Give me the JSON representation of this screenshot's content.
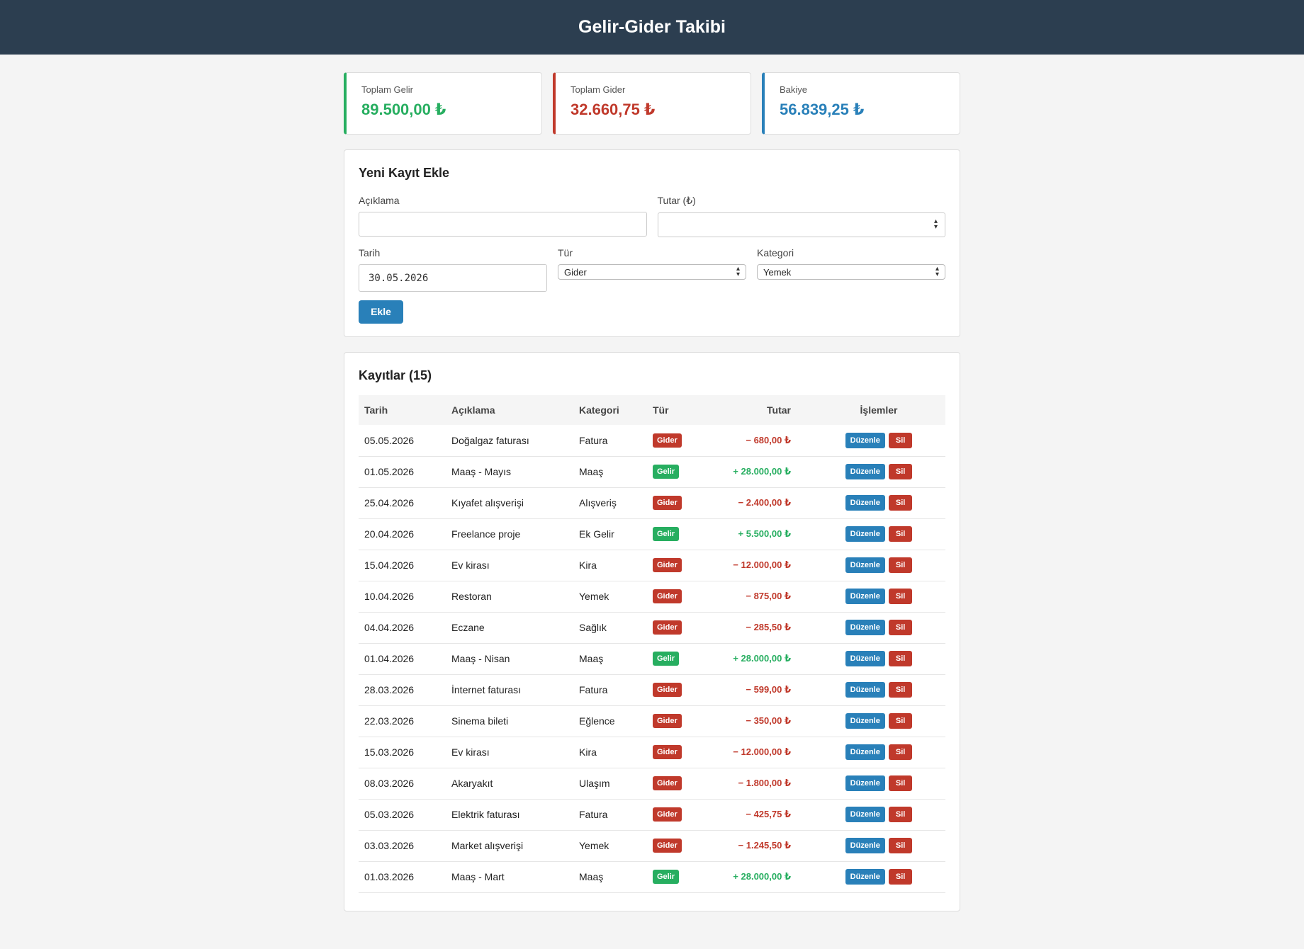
{
  "header": {
    "title": "Gelir-Gider Takibi"
  },
  "summary": {
    "income": {
      "label": "Toplam Gelir",
      "value": "89.500,00 ₺"
    },
    "expense": {
      "label": "Toplam Gider",
      "value": "32.660,75 ₺"
    },
    "balance": {
      "label": "Bakiye",
      "value": "56.839,25 ₺"
    }
  },
  "form": {
    "title": "Yeni Kayıt Ekle",
    "description": {
      "label": "Açıklama",
      "value": ""
    },
    "amount": {
      "label": "Tutar (₺)",
      "value": ""
    },
    "date": {
      "label": "Tarih",
      "value": "30.05.2026"
    },
    "type": {
      "label": "Tür",
      "selected": "Gider"
    },
    "category": {
      "label": "Kategori",
      "selected": "Yemek"
    },
    "submit_label": "Ekle"
  },
  "records": {
    "title": "Kayıtlar (15)",
    "columns": [
      "Tarih",
      "Açıklama",
      "Kategori",
      "Tür",
      "Tutar",
      "İşlemler"
    ],
    "edit_label": "Düzenle",
    "delete_label": "Sil",
    "colors": {
      "gider": "#c0392b",
      "gelir": "#27ae60",
      "edit": "#2980b9"
    },
    "rows": [
      {
        "date": "05.05.2026",
        "description": "Doğalgaz faturası",
        "category": "Fatura",
        "type": "Gider",
        "amount": "− 680,00 ₺"
      },
      {
        "date": "01.05.2026",
        "description": "Maaş - Mayıs",
        "category": "Maaş",
        "type": "Gelir",
        "amount": "+ 28.000,00 ₺"
      },
      {
        "date": "25.04.2026",
        "description": "Kıyafet alışverişi",
        "category": "Alışveriş",
        "type": "Gider",
        "amount": "− 2.400,00 ₺"
      },
      {
        "date": "20.04.2026",
        "description": "Freelance proje",
        "category": "Ek Gelir",
        "type": "Gelir",
        "amount": "+ 5.500,00 ₺"
      },
      {
        "date": "15.04.2026",
        "description": "Ev kirası",
        "category": "Kira",
        "type": "Gider",
        "amount": "− 12.000,00 ₺"
      },
      {
        "date": "10.04.2026",
        "description": "Restoran",
        "category": "Yemek",
        "type": "Gider",
        "amount": "− 875,00 ₺"
      },
      {
        "date": "04.04.2026",
        "description": "Eczane",
        "category": "Sağlık",
        "type": "Gider",
        "amount": "− 285,50 ₺"
      },
      {
        "date": "01.04.2026",
        "description": "Maaş - Nisan",
        "category": "Maaş",
        "type": "Gelir",
        "amount": "+ 28.000,00 ₺"
      },
      {
        "date": "28.03.2026",
        "description": "İnternet faturası",
        "category": "Fatura",
        "type": "Gider",
        "amount": "− 599,00 ₺"
      },
      {
        "date": "22.03.2026",
        "description": "Sinema bileti",
        "category": "Eğlence",
        "type": "Gider",
        "amount": "− 350,00 ₺"
      },
      {
        "date": "15.03.2026",
        "description": "Ev kirası",
        "category": "Kira",
        "type": "Gider",
        "amount": "− 12.000,00 ₺"
      },
      {
        "date": "08.03.2026",
        "description": "Akaryakıt",
        "category": "Ulaşım",
        "type": "Gider",
        "amount": "− 1.800,00 ₺"
      },
      {
        "date": "05.03.2026",
        "description": "Elektrik faturası",
        "category": "Fatura",
        "type": "Gider",
        "amount": "− 425,75 ₺"
      },
      {
        "date": "03.03.2026",
        "description": "Market alışverişi",
        "category": "Yemek",
        "type": "Gider",
        "amount": "− 1.245,50 ₺"
      },
      {
        "date": "01.03.2026",
        "description": "Maaş - Mart",
        "category": "Maaş",
        "type": "Gelir",
        "amount": "+ 28.000,00 ₺"
      }
    ]
  }
}
